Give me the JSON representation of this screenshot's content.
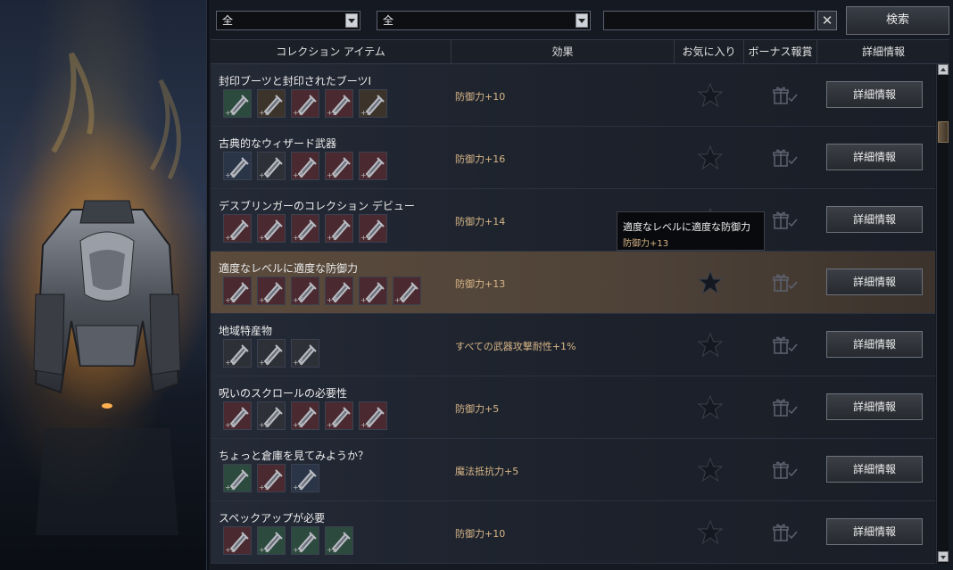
{
  "filters": {
    "filter1": "全",
    "filter2": "全"
  },
  "search": {
    "value": "",
    "clear_label": "✕",
    "button_label": "検索"
  },
  "table": {
    "headers": [
      "コレクション アイテム",
      "効果",
      "お気に入り",
      "ボーナス報賞",
      "詳細情報"
    ]
  },
  "rows": [
    {
      "name": "封印ブーツと封印されたブーツI",
      "effect": "防御力+10",
      "detail_label": "詳細情報",
      "items": [
        {
          "count": "+5",
          "color": "#2c4a3e"
        },
        {
          "count": "+5",
          "color": "#3c342a"
        },
        {
          "count": "+6",
          "color": "#4a2a30"
        },
        {
          "count": "+5",
          "color": "#4a2a30"
        },
        {
          "count": "+5",
          "color": "#3c342a"
        }
      ]
    },
    {
      "name": "古典的なウィザード武器",
      "effect": "防御力+16",
      "detail_label": "詳細情報",
      "items": [
        {
          "count": "+5",
          "color": "#2a3548"
        },
        {
          "count": "+7",
          "color": "#2e3038"
        },
        {
          "count": "+7",
          "color": "#4a2a30"
        },
        {
          "count": "+9",
          "color": "#4a2a30"
        },
        {
          "count": "+9",
          "color": "#4a2a30"
        }
      ]
    },
    {
      "name": "デスブリンガーのコレクション デビュー",
      "effect": "防御力+14",
      "detail_label": "詳細情報",
      "items": [
        {
          "count": "+5",
          "color": "#4a2a30"
        },
        {
          "count": "+9",
          "color": "#4a2a30"
        },
        {
          "count": "+9",
          "color": "#4a2a30"
        },
        {
          "count": "+9",
          "color": "#4a2a30"
        },
        {
          "count": "+9",
          "color": "#4a2a30"
        }
      ]
    },
    {
      "name": "適度なレベルに適度な防御力",
      "effect": "防御力+13",
      "detail_label": "詳細情報",
      "selected": true,
      "items": [
        {
          "count": "+5",
          "color": "#4a2a30"
        },
        {
          "count": "+5",
          "color": "#4a2a30"
        },
        {
          "count": "+7",
          "color": "#4a2a30"
        },
        {
          "count": "+7",
          "color": "#4a2a30"
        },
        {
          "count": "+7",
          "color": "#4a2a30"
        },
        {
          "count": "+7",
          "color": "#4a2a30"
        }
      ]
    },
    {
      "name": "地域特産物",
      "effect": "すべての武器攻撃耐性+1%",
      "detail_label": "詳細情報",
      "items": [
        {
          "count": "+7",
          "color": "#2e3038"
        },
        {
          "count": "+7",
          "color": "#2e3038"
        },
        {
          "count": "+7",
          "color": "#2e3038"
        }
      ]
    },
    {
      "name": "呪いのスクロールの必要性",
      "effect": "防御力+5",
      "detail_label": "詳細情報",
      "items": [
        {
          "count": "+3",
          "color": "#4a2a30"
        },
        {
          "count": "+3",
          "color": "#2e3038"
        },
        {
          "count": "+3",
          "color": "#4a2a30"
        },
        {
          "count": "+3",
          "color": "#4a2a30"
        },
        {
          "count": "+3",
          "color": "#4a2a30"
        }
      ]
    },
    {
      "name": "ちょっと倉庫を見てみようか？",
      "effect": "魔法抵抗力+5",
      "detail_label": "詳細情報",
      "items": [
        {
          "count": "+5",
          "color": "#2c4a3e"
        },
        {
          "count": "+5",
          "color": "#4a2a30"
        },
        {
          "count": "+5",
          "color": "#2a3548"
        }
      ]
    },
    {
      "name": "スペックアップが必要",
      "effect": "防御力+10",
      "detail_label": "詳細情報",
      "items": [
        {
          "count": "+5",
          "color": "#4a2a30"
        },
        {
          "count": "+5",
          "color": "#2c4a3e"
        },
        {
          "count": "+5",
          "color": "#2c4a3e"
        },
        {
          "count": "+5",
          "color": "#2c4a3e"
        }
      ]
    }
  ],
  "tooltip": {
    "title": "適度なレベルに適度な防御力",
    "effect": "防御力+13"
  },
  "colors": {
    "accent": "#d8b687",
    "selected_row": "#5b4b3c",
    "panel": "#141922"
  }
}
